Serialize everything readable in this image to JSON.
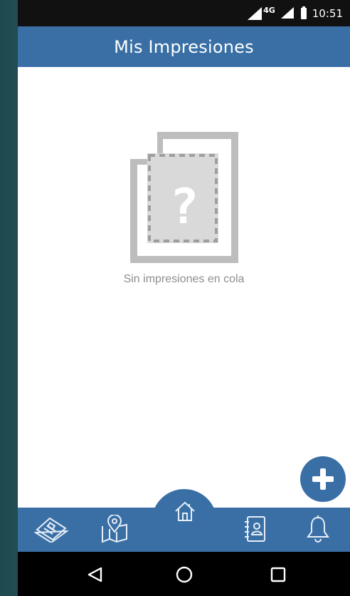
{
  "status_bar": {
    "network": "4G",
    "time": "10:51",
    "icons": [
      "signal-icon",
      "signal-icon",
      "battery-icon"
    ]
  },
  "header": {
    "title": "Mis Impresiones"
  },
  "empty_state": {
    "icon": "unknown-document-icon",
    "message": "Sin impresiones en cola"
  },
  "fab": {
    "icon": "plus-icon"
  },
  "bottom_nav": {
    "items": [
      {
        "name": "nav-news",
        "icon": "newspaper-icon"
      },
      {
        "name": "nav-map",
        "icon": "map-pin-icon"
      },
      {
        "name": "nav-home",
        "icon": "home-icon",
        "active": true
      },
      {
        "name": "nav-contacts",
        "icon": "address-book-icon"
      },
      {
        "name": "nav-notifications",
        "icon": "bell-icon"
      }
    ]
  },
  "system_nav": {
    "items": [
      "back-icon",
      "home-circle-icon",
      "recents-icon"
    ]
  },
  "colors": {
    "primary": "#3a6fa6",
    "statusbar": "#111111",
    "empty_text": "#8e8e8e",
    "icon_gray": "#bdbdbd"
  }
}
